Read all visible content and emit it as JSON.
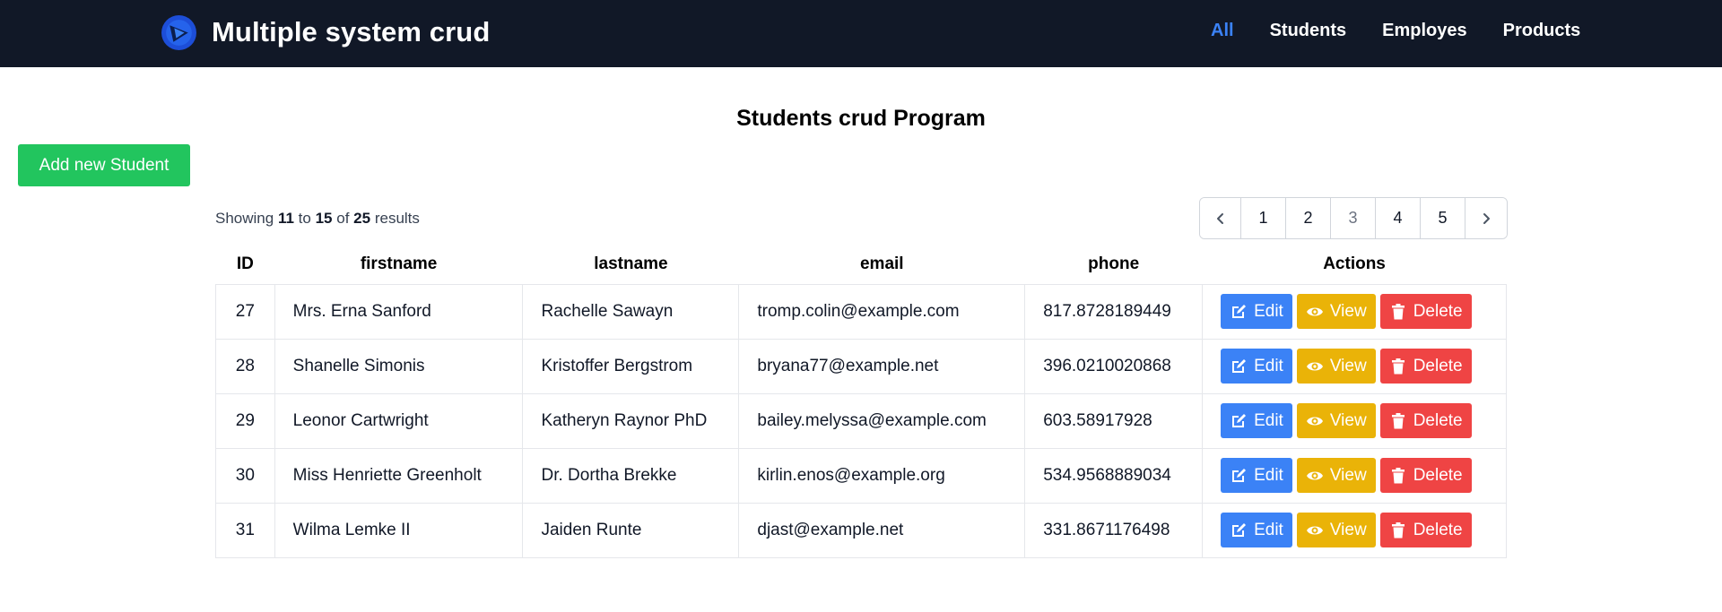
{
  "navbar": {
    "brand_title": "Multiple system crud",
    "links": [
      {
        "label": "All",
        "active": true
      },
      {
        "label": "Students",
        "active": false
      },
      {
        "label": "Employes",
        "active": false
      },
      {
        "label": "Products",
        "active": false
      }
    ]
  },
  "page": {
    "title": "Students crud Program",
    "add_button_label": "Add new Student"
  },
  "results": {
    "prefix": "Showing",
    "from": "11",
    "to_word": "to",
    "to": "15",
    "of_word": "of",
    "total": "25",
    "suffix": "results"
  },
  "pagination": {
    "prev_icon": "chevron-left-icon",
    "next_icon": "chevron-right-icon",
    "pages": [
      "1",
      "2",
      "3",
      "4",
      "5"
    ],
    "current_page": "3"
  },
  "table": {
    "headers": [
      "ID",
      "firstname",
      "lastname",
      "email",
      "phone",
      "Actions"
    ],
    "rows": [
      {
        "id": "27",
        "firstname": "Mrs. Erna Sanford",
        "lastname": "Rachelle Sawayn",
        "email": "tromp.colin@example.com",
        "phone": "817.8728189449"
      },
      {
        "id": "28",
        "firstname": "Shanelle Simonis",
        "lastname": "Kristoffer Bergstrom",
        "email": "bryana77@example.net",
        "phone": "396.0210020868"
      },
      {
        "id": "29",
        "firstname": "Leonor Cartwright",
        "lastname": "Katheryn Raynor PhD",
        "email": "bailey.melyssa@example.com",
        "phone": "603.58917928"
      },
      {
        "id": "30",
        "firstname": "Miss Henriette Greenholt",
        "lastname": "Dr. Dortha Brekke",
        "email": "kirlin.enos@example.org",
        "phone": "534.9568889034"
      },
      {
        "id": "31",
        "firstname": "Wilma Lemke II",
        "lastname": "Jaiden Runte",
        "email": "djast@example.net",
        "phone": "331.8671176498"
      }
    ],
    "actions": {
      "edit_label": "Edit",
      "view_label": "View",
      "delete_label": "Delete",
      "edit_icon": "edit-icon",
      "view_icon": "eye-icon",
      "delete_icon": "trash-icon"
    }
  },
  "colors": {
    "navbar_bg": "#111827",
    "active_link": "#3b82f6",
    "add_button": "#22c55e",
    "edit_button": "#3b82f6",
    "view_button": "#eab308",
    "delete_button": "#ef4444"
  }
}
